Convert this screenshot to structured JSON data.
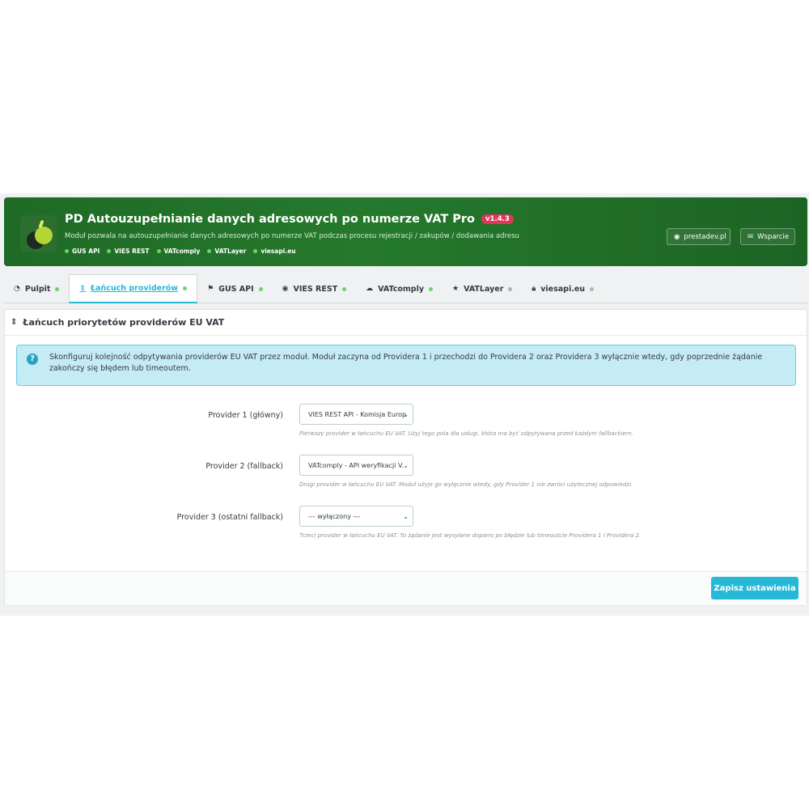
{
  "header": {
    "title": "PD Autouzupełnianie danych adresowych po numerze VAT Pro",
    "version": "v1.4.3",
    "subtitle": "Moduł pozwala na autouzupełnianie danych adresowych po numerze VAT podczas procesu rejestracji / zakupów / dodawania adresu",
    "providers": [
      {
        "label": "GUS API",
        "active": true
      },
      {
        "label": "VIES REST",
        "active": true
      },
      {
        "label": "VATcomply",
        "active": true
      },
      {
        "label": "VATLayer",
        "active": true
      },
      {
        "label": "viesapi.eu",
        "active": true
      }
    ],
    "site_button": "prestadev.pl",
    "support_button": "Wsparcie"
  },
  "tabs": [
    {
      "label": "Pulpit",
      "icon": "dashboard-icon",
      "status": "green"
    },
    {
      "label": "Łańcuch providerów",
      "icon": "sort-icon",
      "status": "green",
      "active": true
    },
    {
      "label": "GUS API",
      "icon": "flag-icon",
      "status": "green"
    },
    {
      "label": "VIES REST",
      "icon": "globe-icon",
      "status": "green"
    },
    {
      "label": "VATcomply",
      "icon": "cloud-icon",
      "status": "green"
    },
    {
      "label": "VATLayer",
      "icon": "star-icon",
      "status": "gray"
    },
    {
      "label": "viesapi.eu",
      "icon": "lock-icon",
      "status": "gray"
    }
  ],
  "panel": {
    "title": "Łańcuch priorytetów providerów EU VAT",
    "info": "Skonfiguruj kolejność odpytywania providerów EU VAT przez moduł. Moduł zaczyna od Providera 1 i przechodzi do Providera 2 oraz Providera 3 wyłącznie wtedy, gdy poprzednie żądanie zakończy się błędem lub timeoutem.",
    "fields": [
      {
        "label": "Provider 1 (główny)",
        "value": "VIES REST API - Komisja Europ",
        "help": "Pierwszy provider w łańcuchu EU VAT. Użyj tego pola dla usługi, która ma być odpytywana przed każdym fallbackiem."
      },
      {
        "label": "Provider 2 (fallback)",
        "value": "VATcomply - API weryfikacji V.",
        "help": "Drugi provider w łańcuchu EU VAT. Moduł użyje go wyłącznie wtedy, gdy Provider 1 nie zwróci użytecznej odpowiedzi."
      },
      {
        "label": "Provider 3 (ostatni fallback)",
        "value": "--- wyłączony ---",
        "help": "Trzeci provider w łańcuchu EU VAT. To żądanie jest wysyłane dopiero po błędzie lub timeoutcie Providera 1 i Providera 2."
      }
    ],
    "save_button": "Zapisz ustawienia"
  },
  "colors": {
    "banner_green": "#1f6a26",
    "accent": "#25b9d7",
    "status_on": "#4cbb17",
    "status_off": "#a9b8aa"
  }
}
